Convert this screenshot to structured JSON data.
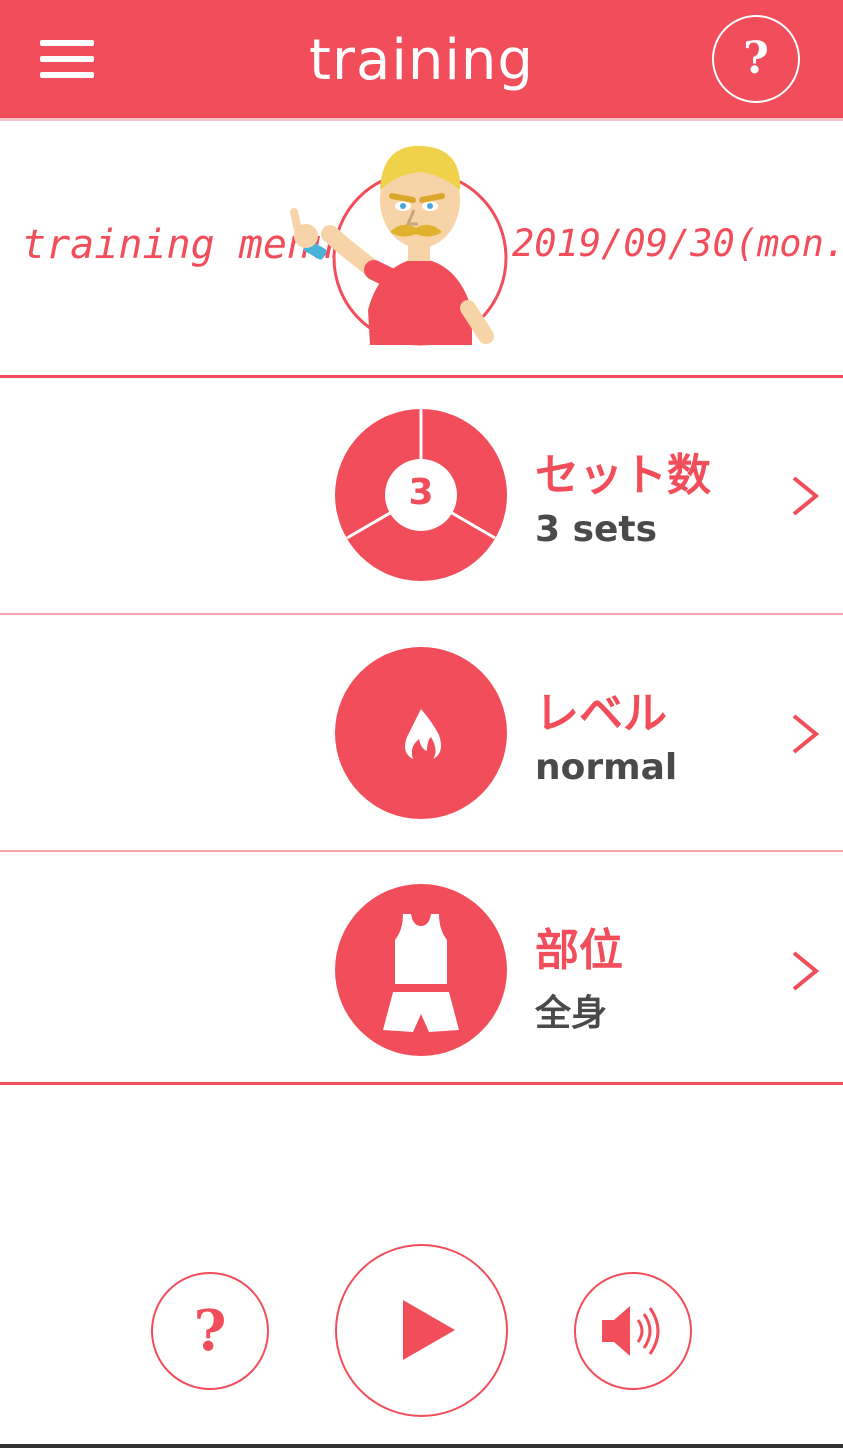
{
  "app": {
    "title": "training",
    "accent_color": "#f24d5a",
    "icons": {
      "menu": "hamburger-menu-icon",
      "help": "question-mark-icon",
      "play": "play-icon",
      "sound": "speaker-icon"
    }
  },
  "banner": {
    "label": "training menu",
    "date": "2019/09/30(mon."
  },
  "rows": [
    {
      "title": "セット数",
      "value": "3 sets",
      "badge": "3",
      "icon": "sets-pie-icon"
    },
    {
      "title": "レベル",
      "value": "normal",
      "icon": "flame-icon"
    },
    {
      "title": "部位",
      "value": "全身",
      "icon": "body-clothes-icon"
    }
  ],
  "bottom": {
    "help_label": "?",
    "play_label": "play",
    "sound_label": "sound"
  }
}
